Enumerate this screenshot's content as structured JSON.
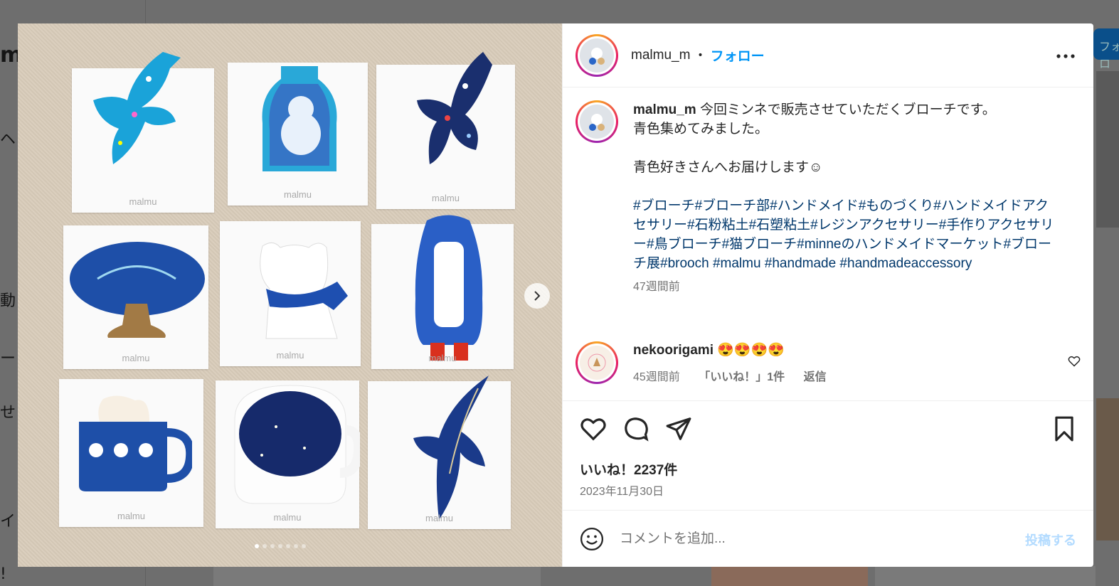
{
  "background": {
    "right_button_label": "フォロ",
    "sidebar_fragments": [
      "m",
      "ヘ",
      "動",
      "ー",
      "せ",
      "イ",
      "!"
    ]
  },
  "media": {
    "brand_labels": [
      "malmu",
      "malmu",
      "malmu",
      "malmu",
      "malmu",
      "malmu",
      "malmu",
      "malmu",
      "malmu"
    ],
    "carousel_index": 0,
    "carousel_count": 7
  },
  "post": {
    "username": "malmu_m",
    "separator": "•",
    "follow_label": "フォロー",
    "more_icon": "more-horizontal-icon"
  },
  "caption": {
    "username": "malmu_m",
    "line1": "今回ミンネで販売させていただくブローチです。",
    "line2": "青色集めてみました。",
    "line3": "青色好きさんへお届けします☺",
    "hashtags": "#ブローチ#ブローチ部#ハンドメイド#ものづくり#ハンドメイドアクセサリー#石粉粘土#石塑粘土#レジンアクセサリー#手作りアクセサリー#鳥ブローチ#猫ブローチ#minneのハンドメイドマーケット#ブローチ展#brooch #malmu #handmade #handmadeaccessory",
    "time": "47週間前"
  },
  "comment": {
    "username": "nekoorigami",
    "text": "😍😍😍😍",
    "time": "45週間前",
    "likes": "「いいね！」1件",
    "reply": "返信"
  },
  "actions": {
    "likes": "いいね！2237件",
    "date": "2023年11月30日"
  },
  "comment_box": {
    "placeholder": "コメントを追加...",
    "post_label": "投稿する"
  },
  "colors": {
    "accent": "#0095f6",
    "hashtag": "#00376b",
    "muted": "#737373",
    "brooch_blue": "#1e4fa8",
    "brooch_cyan": "#1aa3d9"
  }
}
